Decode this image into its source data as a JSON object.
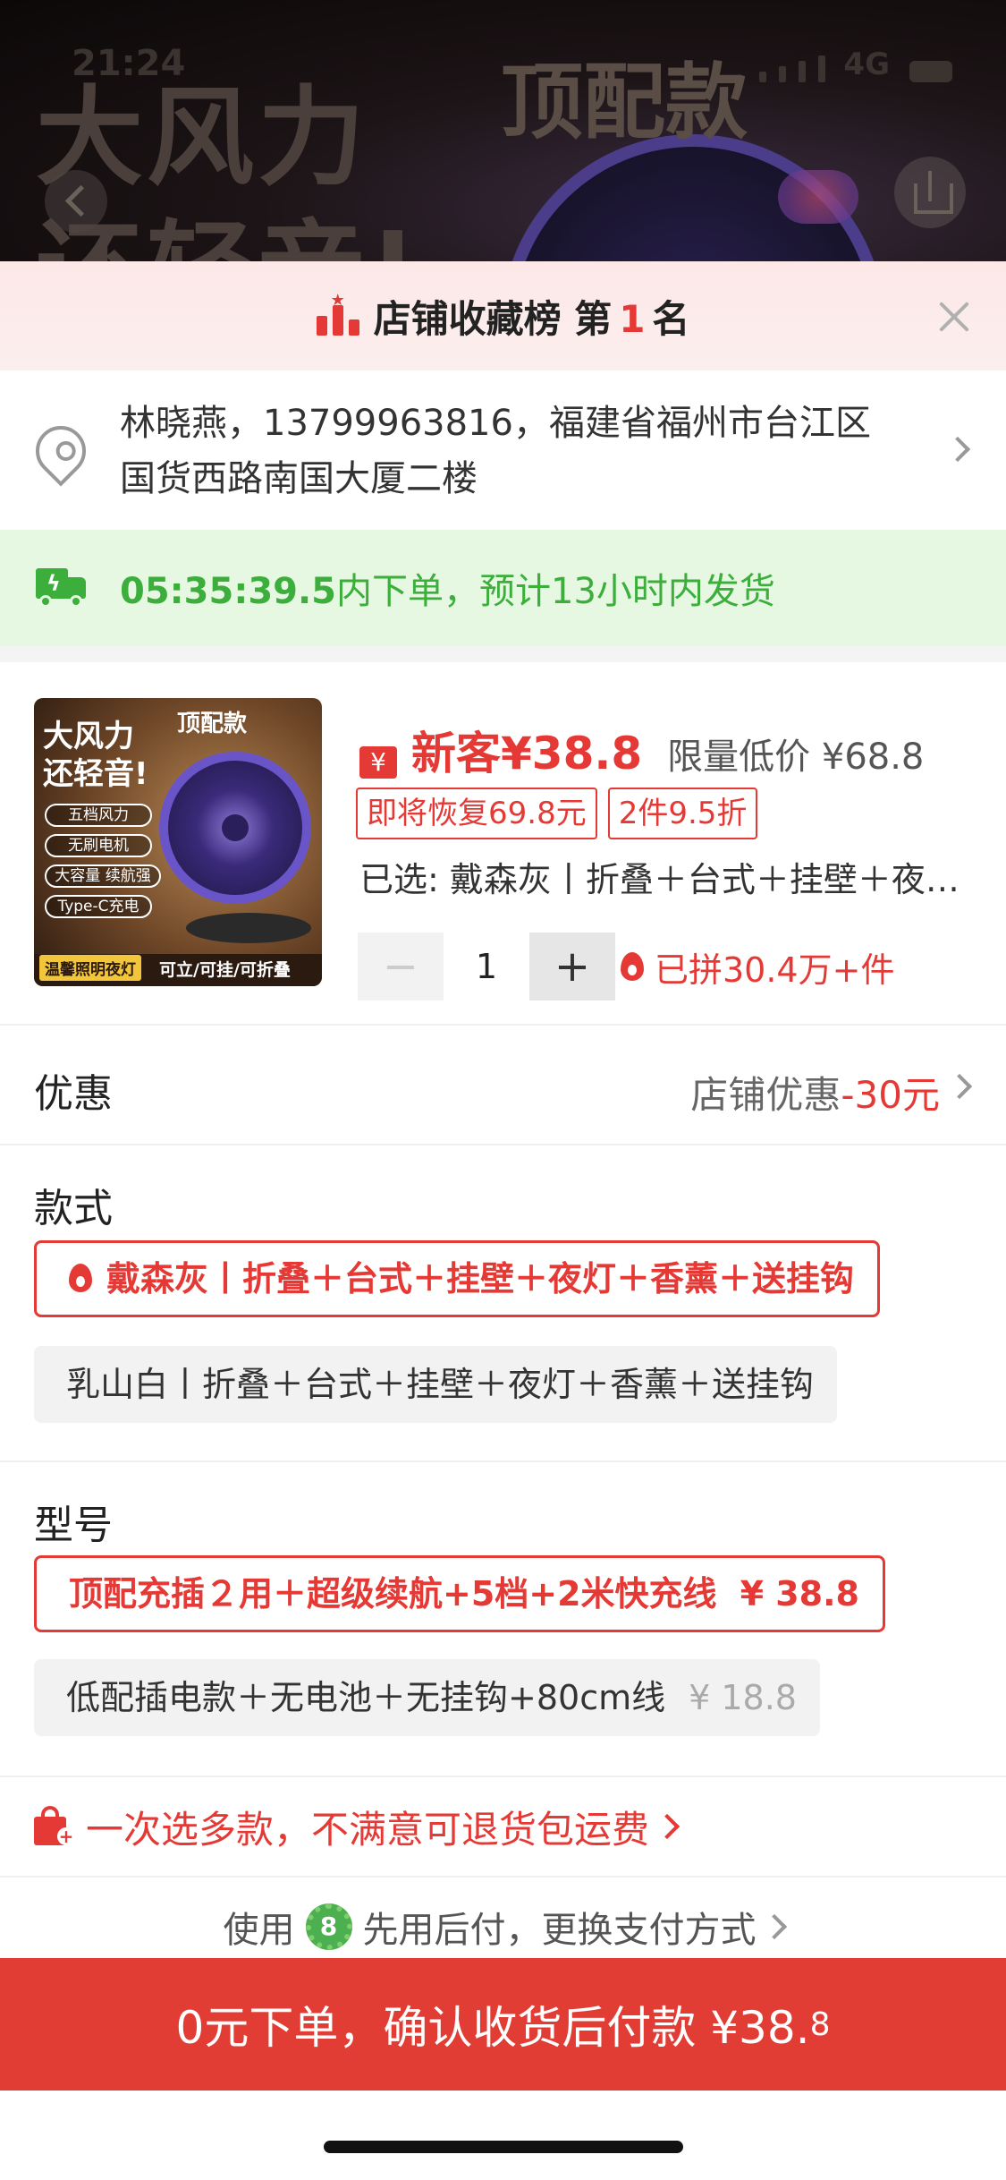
{
  "backdrop": {
    "status_time": "21:24",
    "network": "4G",
    "headline": "大风力\n还轻音!",
    "badge": "顶配款"
  },
  "rank_banner": {
    "prefix": "店铺收藏榜 第",
    "number": "1",
    "suffix": "名"
  },
  "address": {
    "text": "林晓燕，13799963816，福建省福州市台江区国货西路南国大厦二楼"
  },
  "shipping": {
    "countdown": "05:35:39.5",
    "text": "内下单，预计13小时内发货"
  },
  "product": {
    "thumb": {
      "headline": "大风力\n还轻音!",
      "badge": "顶配款",
      "features": [
        "五档风力",
        "无刷电机",
        "大容量 续航强",
        "Type-C充电"
      ],
      "footer_tag": "温馨照明夜灯",
      "footer_text": "可立/可挂/可折叠"
    },
    "yen_icon": "¥",
    "new_price": "新客¥38.8",
    "old_price": "限量低价 ¥68.8",
    "tags": [
      "即将恢复69.8元",
      "2件9.5折"
    ],
    "selected": "已选: 戴森灰丨折叠＋台式＋挂壁＋夜灯＋香薰＋送挂钩",
    "quantity": "1",
    "minus": "−",
    "plus": "+",
    "sold": "已拼30.4万+件"
  },
  "discount": {
    "label": "优惠",
    "value_prefix": "店铺优惠",
    "value_amount": "-30元"
  },
  "style": {
    "title": "款式",
    "options": [
      {
        "label": "戴森灰丨折叠＋台式＋挂壁＋夜灯＋香薰＋送挂钩",
        "selected": true
      },
      {
        "label": "乳山白丨折叠＋台式＋挂壁＋夜灯＋香薰＋送挂钩",
        "selected": false
      }
    ]
  },
  "model": {
    "title": "型号",
    "options": [
      {
        "label": "顶配充插２用＋超级续航+5档+2米快充线",
        "price": "¥ 38.8",
        "selected": true
      },
      {
        "label": "低配插电款＋无电池＋无挂钩+80cm线",
        "price": "¥ 18.8",
        "selected": false
      }
    ]
  },
  "promo": {
    "text": "一次选多款，不满意可退货包运费"
  },
  "pay": {
    "prefix": "使用",
    "badge_char": "8",
    "text": "先用后付，更换支付方式"
  },
  "cta": {
    "text": "0元下单，确认收货后付款 ¥38.",
    "small": "8"
  },
  "colors": {
    "accent_red": "#e53935",
    "cta_red": "#e23d35",
    "ship_green": "#3bae3b",
    "ship_bg": "#e6f7e2",
    "rank_bg": "#fde8e8"
  }
}
